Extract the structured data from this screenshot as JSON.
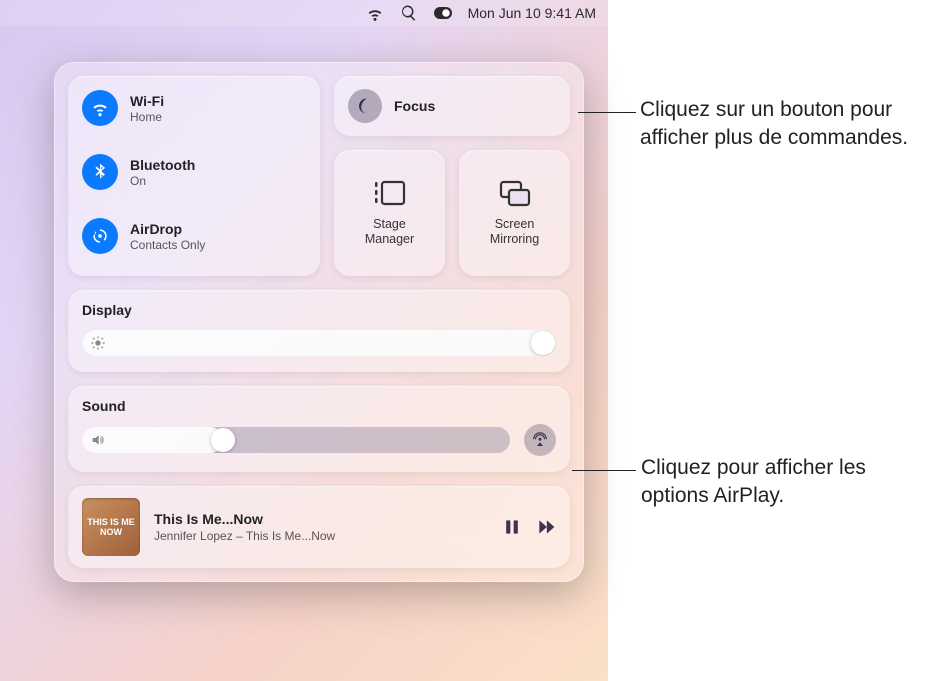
{
  "menubar": {
    "datetime": "Mon Jun 10  9:41 AM"
  },
  "conn": {
    "wifi": {
      "title": "Wi-Fi",
      "subtitle": "Home"
    },
    "bluetooth": {
      "title": "Bluetooth",
      "subtitle": "On"
    },
    "airdrop": {
      "title": "AirDrop",
      "subtitle": "Contacts Only"
    }
  },
  "focus": {
    "label": "Focus"
  },
  "stage": {
    "label": "Stage\nManager"
  },
  "mirror": {
    "label": "Screen\nMirroring"
  },
  "display": {
    "header": "Display"
  },
  "sound": {
    "header": "Sound"
  },
  "nowplaying": {
    "art_text": "THIS IS ME NOW",
    "title": "This Is Me...Now",
    "artist": "Jennifer Lopez – This Is Me...Now"
  },
  "callouts": {
    "focus": "Cliquez sur un bouton pour afficher plus de commandes.",
    "airplay": "Cliquez pour afficher les options AirPlay."
  }
}
